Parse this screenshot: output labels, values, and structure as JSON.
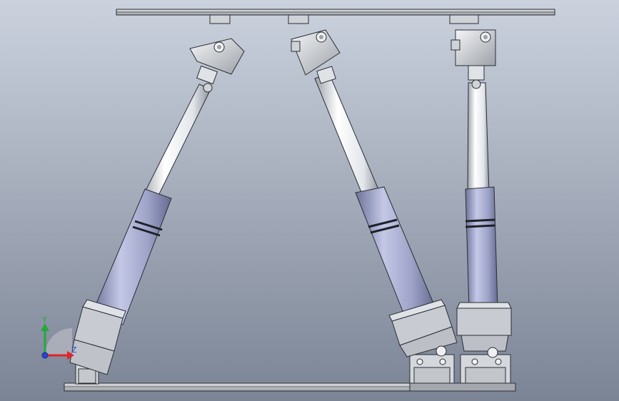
{
  "viewport": {
    "background_top": "#c9d0dc",
    "background_bottom": "#7a8394",
    "icon": "cad-3d-viewport"
  },
  "model": {
    "parts": [
      "top-platform",
      "base-plate",
      "actuator-leg-left",
      "actuator-leg-middle",
      "actuator-leg-right"
    ],
    "colors": {
      "piston": "#e6e9ee",
      "cylinder": "#9ea3c6",
      "joint": "#d9dde2",
      "plate": "#b9bcc2",
      "edge": "#2b2d33"
    }
  },
  "triad": {
    "y_label": "Y",
    "z_label": "Z",
    "x_color": "#e0242a",
    "y_color": "#25a83a",
    "z_color": "#2447d6"
  }
}
